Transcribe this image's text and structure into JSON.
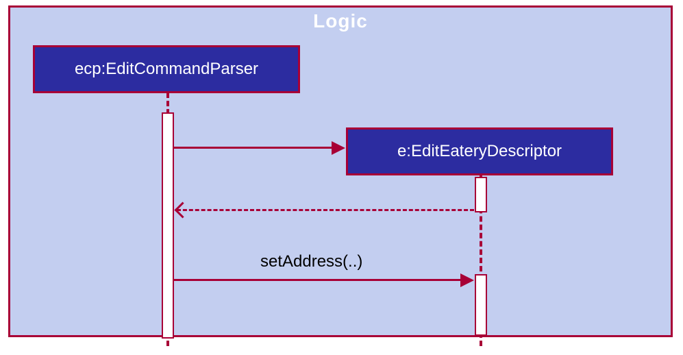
{
  "frame": {
    "title": "Logic"
  },
  "participants": {
    "ecp": "ecp:EditCommandParser",
    "e": "e:EditEateryDescriptor"
  },
  "messages": {
    "create": "",
    "returnCreate": "",
    "setAddress": "setAddress(..)"
  },
  "chart_data": {
    "type": "sequence-diagram",
    "frame": "Logic",
    "participants": [
      {
        "id": "ecp",
        "label": "ecp:EditCommandParser"
      },
      {
        "id": "e",
        "label": "e:EditEateryDescriptor"
      }
    ],
    "messages": [
      {
        "from": "ecp",
        "to": "e",
        "label": "",
        "kind": "sync-create"
      },
      {
        "from": "e",
        "to": "ecp",
        "label": "",
        "kind": "return"
      },
      {
        "from": "ecp",
        "to": "e",
        "label": "setAddress(..)",
        "kind": "sync"
      }
    ]
  }
}
